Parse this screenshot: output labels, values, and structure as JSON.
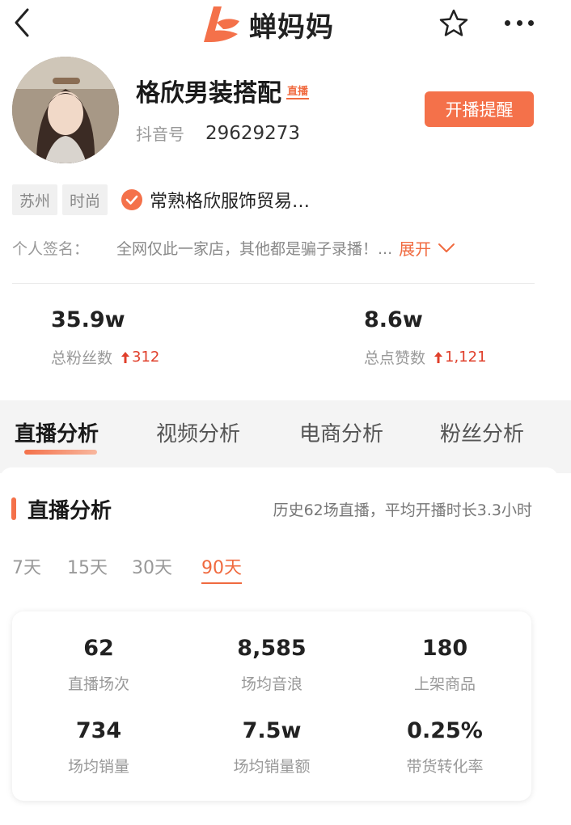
{
  "header": {
    "brand": "蝉妈妈"
  },
  "profile": {
    "name": "格欣男装搭配",
    "live_badge": "直播",
    "douyin_label": "抖音号",
    "douyin_id": "29629273",
    "remind_button": "开播提醒",
    "tags": [
      "苏州",
      "时尚"
    ],
    "company": "常熟格欣服饰贸易…",
    "signature_label": "个人签名：",
    "signature": "全网仅此一家店，其他都是骗子录播！...",
    "expand_label": "展开"
  },
  "stats": [
    {
      "value": "35.9w",
      "label": "总粉丝数",
      "delta": "312"
    },
    {
      "value": "8.6w",
      "label": "总点赞数",
      "delta": "1,121"
    }
  ],
  "tabs": [
    "直播分析",
    "视频分析",
    "电商分析",
    "粉丝分析"
  ],
  "live": {
    "title": "直播分析",
    "summary": "历史62场直播，平均开播时长3.3小时",
    "ranges": [
      "7天",
      "15天",
      "30天",
      "90天"
    ],
    "active_range": "90天",
    "metrics": [
      {
        "value": "62",
        "label": "直播场次"
      },
      {
        "value": "8,585",
        "label": "场均音浪"
      },
      {
        "value": "180",
        "label": "上架商品"
      },
      {
        "value": "734",
        "label": "场均销量"
      },
      {
        "value": "7.5w",
        "label": "场均销量额"
      },
      {
        "value": "0.25%",
        "label": "带货转化率"
      }
    ]
  },
  "colors": {
    "accent": "#f4714a",
    "delta_up": "#e0402c"
  }
}
